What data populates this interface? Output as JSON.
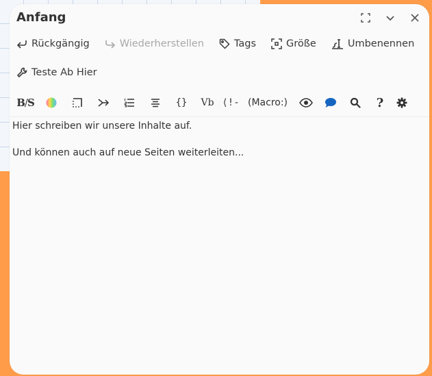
{
  "window": {
    "title": "Anfang",
    "controls": [
      "fullscreen-icon",
      "chevron-down-icon",
      "close-icon"
    ]
  },
  "toolbar": {
    "undo_label": "Rückgängig",
    "redo_label": "Wiederherstellen",
    "tags_label": "Tags",
    "size_label": "Größe",
    "rename_label": "Umbenennen",
    "test_label": "Teste Ab Hier"
  },
  "format_bar": {
    "bs_label": "B/S",
    "vb_label": "Vb",
    "excl_label": "⟨!-",
    "macro_label": "(Macro:)",
    "help_label": "?",
    "icons": [
      "bold-strike-icon",
      "color-wheel-icon",
      "border-icon",
      "chevron-arrow-icon",
      "list-icon",
      "align-center-icon",
      "braces-icon",
      "verbatim-icon",
      "comment-icon",
      "macro-icon",
      "eye-icon",
      "speech-bubble-icon",
      "search-icon",
      "help-icon",
      "gear-icon"
    ]
  },
  "content": {
    "line1": "Hier schreiben wir unsere Inhalte auf.",
    "line2": "Und können auch auf neue Seiten weiterleiten..."
  },
  "colors": {
    "background_orange": "#ff9c4a",
    "panel": "#fafafa",
    "speech_bubble_blue": "#1565c0",
    "disabled_text": "#a8a8a8"
  }
}
